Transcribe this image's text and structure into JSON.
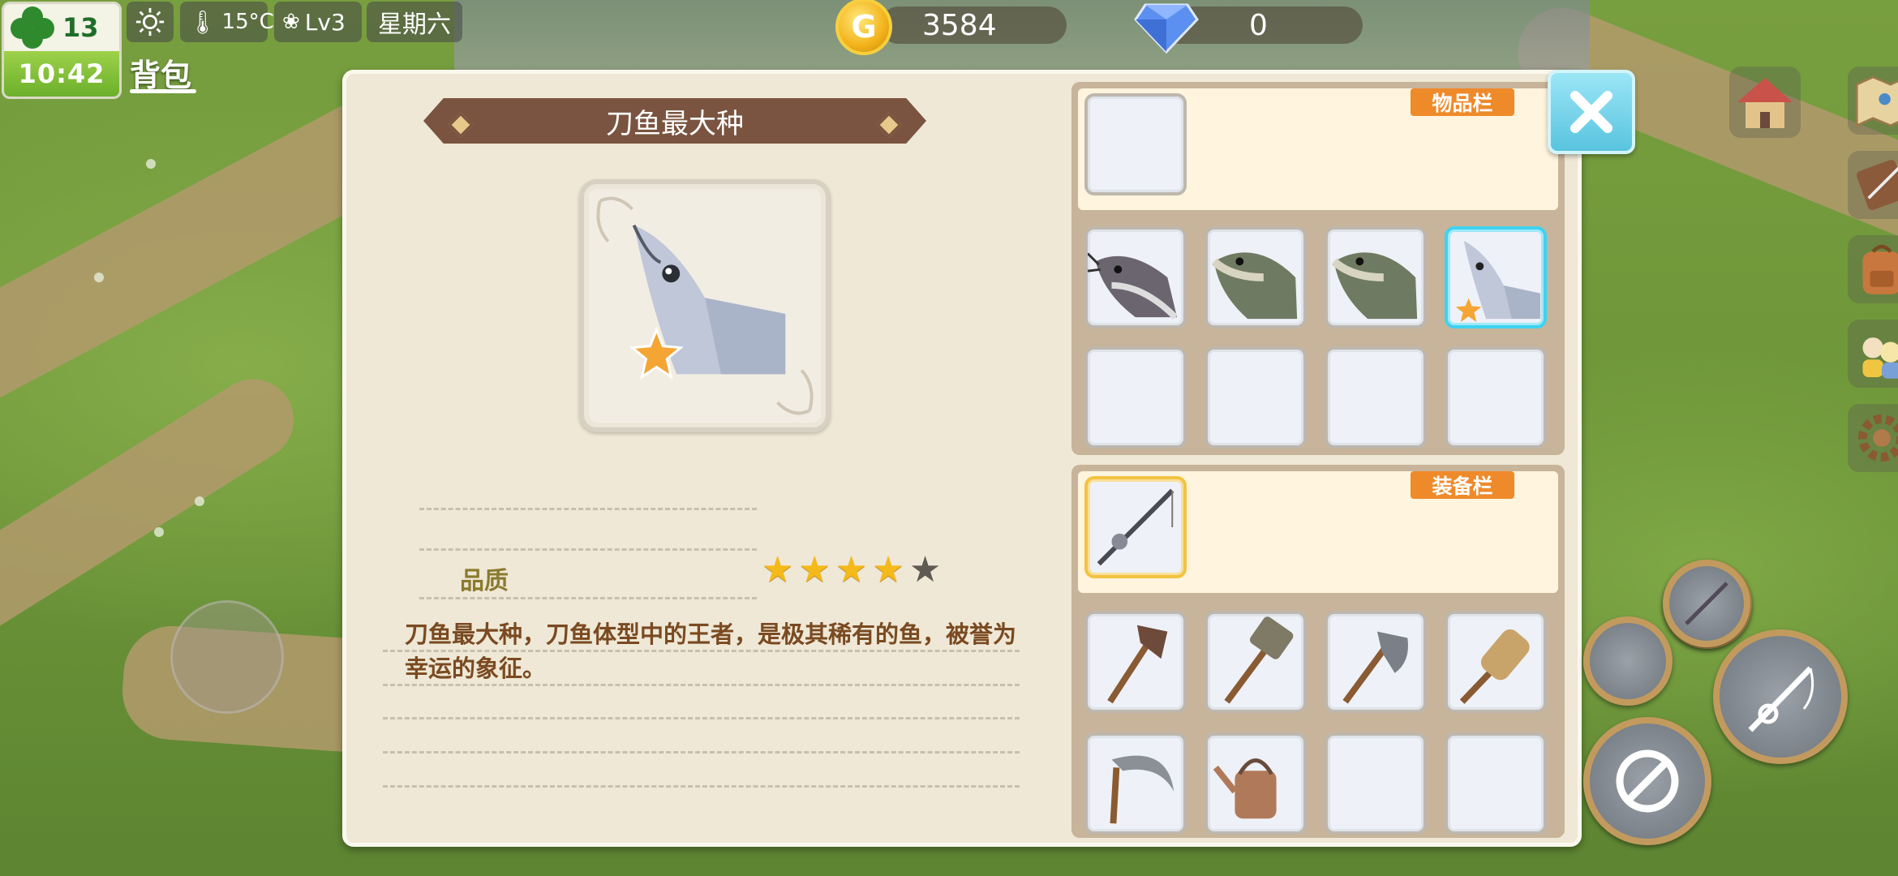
{
  "hud": {
    "clover_count": "13",
    "time": "10:42",
    "weather_icon": "sun-icon",
    "temperature": "15°C",
    "level": "Lv3",
    "weekday": "星期六",
    "gold": "3584",
    "gold_symbol": "G",
    "gems": "0",
    "tab_label": "背包"
  },
  "detail": {
    "item_name": "刀鱼最大种",
    "quality_label": "品质",
    "quality_stars": 4,
    "quality_max": 5,
    "description": "刀鱼最大种，刀鱼体型中的王者，是极其稀有的鱼，被誉为幸运的象征。"
  },
  "inventory": {
    "tag": "物品栏",
    "slots": [
      "empty",
      "catfish",
      "carp",
      "carp",
      "knifefish-selected",
      "empty",
      "empty",
      "empty",
      "empty"
    ]
  },
  "equipment": {
    "tag": "装备栏",
    "equipped": "fishing-rod",
    "tools": [
      "hoe",
      "hammer",
      "axe",
      "brush",
      "sickle",
      "watering-can",
      "empty",
      "empty"
    ]
  },
  "side_menu": [
    "house-icon",
    "map-icon",
    "journal-icon",
    "backpack-icon",
    "friends-icon",
    "settings-gear-icon"
  ],
  "colors": {
    "accent_orange": "#ef8a2a",
    "banner_brown": "#7a5440",
    "star_gold": "#f5b919",
    "selection_blue": "#3fd2f0",
    "selection_gold": "#f2c341"
  }
}
